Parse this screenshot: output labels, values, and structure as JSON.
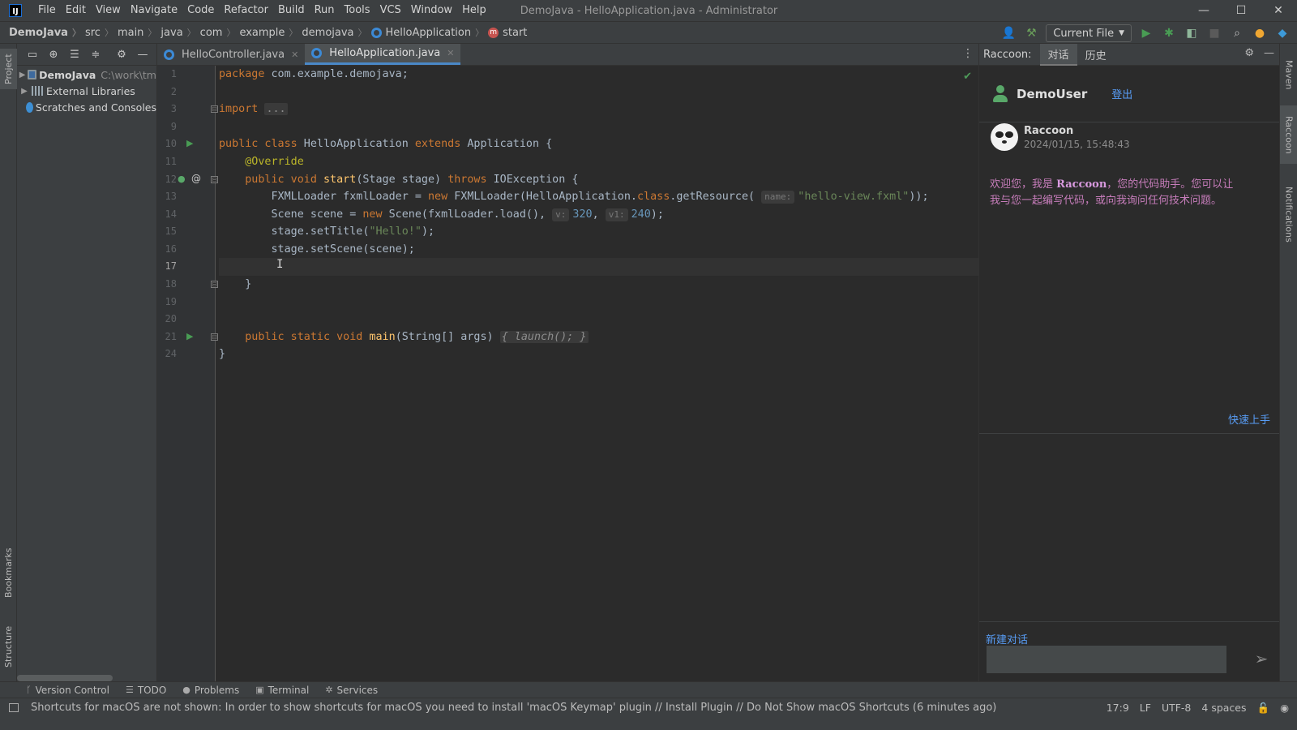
{
  "window": {
    "logo": "IJ",
    "title": "DemoJava - HelloApplication.java - Administrator",
    "controls": {
      "minimize": "—",
      "maximize": "☐",
      "close": "✕"
    }
  },
  "menu": [
    "File",
    "Edit",
    "View",
    "Navigate",
    "Code",
    "Refactor",
    "Build",
    "Run",
    "Tools",
    "VCS",
    "Window",
    "Help"
  ],
  "breadcrumbs": [
    "DemoJava",
    "src",
    "main",
    "java",
    "com",
    "example",
    "demojava",
    "HelloApplication",
    "start"
  ],
  "toolbar": {
    "run_config": "Current File"
  },
  "left_stripe": {
    "project": "Project",
    "bookmarks": "Bookmarks",
    "structure": "Structure"
  },
  "project_tree": {
    "items": [
      {
        "label": "DemoJava",
        "path": "C:\\work\\tm"
      },
      {
        "label": "External Libraries"
      },
      {
        "label": "Scratches and Consoles"
      }
    ]
  },
  "editor": {
    "tabs": [
      {
        "label": "HelloController.java",
        "active": false
      },
      {
        "label": "HelloApplication.java",
        "active": true
      }
    ],
    "line_numbers": [
      "1",
      "2",
      "3",
      "9",
      "10",
      "11",
      "12",
      "13",
      "14",
      "15",
      "16",
      "17",
      "18",
      "19",
      "20",
      "21",
      "24"
    ],
    "current_line": "17",
    "code": {
      "l1_kw": "package",
      "l1_rest": " com.example.demojava;",
      "l3_kw": "import",
      "l3_fold": "...",
      "l10_kw1": "public class",
      "l10_name": " HelloApplication ",
      "l10_kw2": "extends",
      "l10_rest": " Application {",
      "l11_ann": "@Override",
      "l12_kw": "public void",
      "l12_fn": "start",
      "l12_args": "(Stage stage) ",
      "l12_kw2": "throws",
      "l12_rest": " IOException {",
      "l13_a": "FXMLLoader fxmlLoader = ",
      "l13_kw": "new",
      "l13_b": " FXMLLoader(HelloApplication.",
      "l13_kw2": "class",
      "l13_c": ".getResource(",
      "l13_hint": "name:",
      "l13_str": "\"hello-view.fxml\"",
      "l13_d": "));",
      "l14_a": "Scene scene = ",
      "l14_kw": "new",
      "l14_b": " Scene(fxmlLoader.load(), ",
      "l14_hint1": "v:",
      "l14_n1": "320",
      "l14_comma": ", ",
      "l14_hint2": "v1:",
      "l14_n2": "240",
      "l14_c": ");",
      "l15_a": "stage.setTitle(",
      "l15_str": "\"Hello!\"",
      "l15_b": ");",
      "l16": "stage.setScene(scene);",
      "l18": "}",
      "l21_kw": "public static void",
      "l21_fn": "main",
      "l21_args": "(String[] args) ",
      "l21_fold": "{ launch(); }",
      "l24": "}"
    }
  },
  "raccoon": {
    "title": "Raccoon:",
    "tabs": [
      {
        "label": "对话",
        "active": true
      },
      {
        "label": "历史",
        "active": false
      }
    ],
    "user": {
      "name": "DemoUser",
      "logout": "登出"
    },
    "message": {
      "sender": "Raccoon",
      "time": "2024/01/15, 15:48:43",
      "text_before": "欢迎您，我是 ",
      "text_brand": "Raccoon",
      "text_after": "，您的代码助手。您可以让我与您一起编写代码，或向我询问任何技术问题。"
    },
    "quick_start": "快速上手",
    "new_chat": "新建对话",
    "input_placeholder": ""
  },
  "right_stripe": {
    "maven": "Maven",
    "raccoon": "Raccoon",
    "notifications": "Notifications"
  },
  "tool_windows": [
    "Version Control",
    "TODO",
    "Problems",
    "Terminal",
    "Services"
  ],
  "status": {
    "message": "Shortcuts for macOS are not shown: In order to show shortcuts for macOS you need to install 'macOS Keymap' plugin // Install Plugin // Do Not Show macOS Shortcuts (6 minutes ago)",
    "position": "17:9",
    "line_sep": "LF",
    "encoding": "UTF-8",
    "indent": "4 spaces"
  },
  "colors": {
    "accent": "#4a88c7",
    "run_green": "#499c54",
    "link_blue": "#589df6",
    "message_purple": "#c77dbb"
  }
}
